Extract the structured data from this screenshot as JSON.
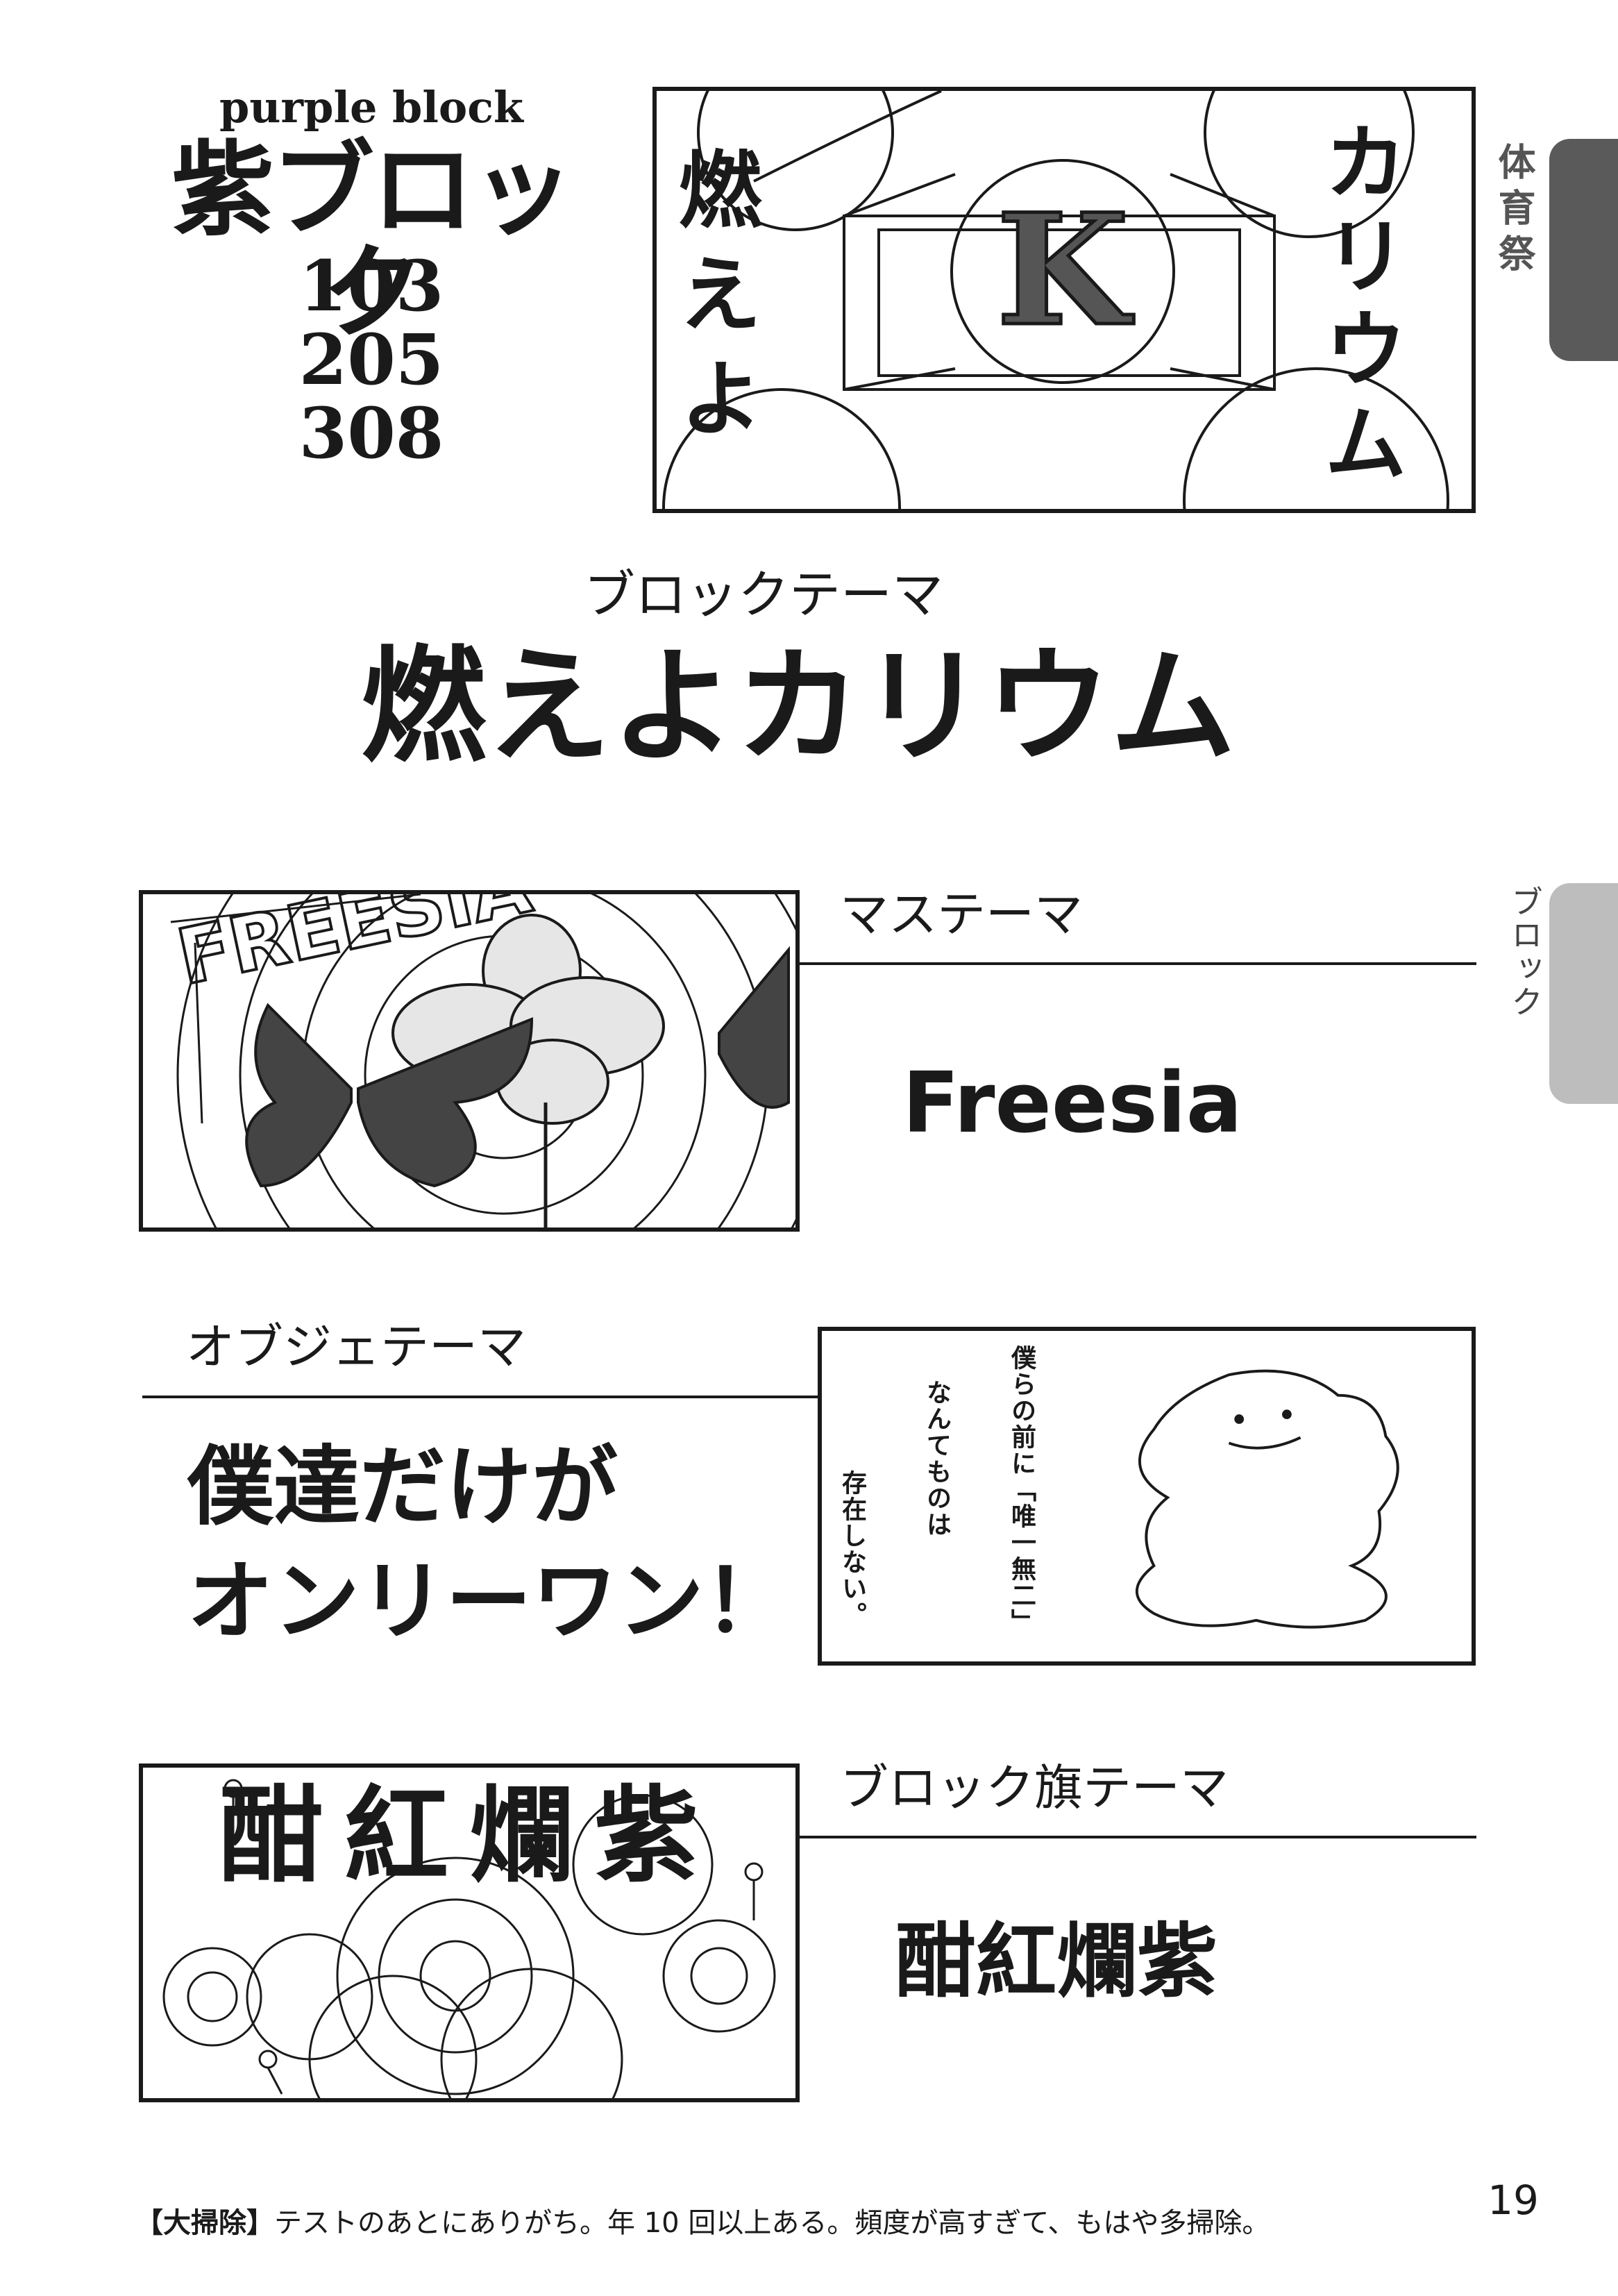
{
  "header": {
    "english_title": "purple block",
    "title": "紫ブロック",
    "classes": [
      "103",
      "205",
      "308"
    ]
  },
  "side_tabs": {
    "section": "体育祭",
    "subsection": "ブロック"
  },
  "block_theme": {
    "label": "ブロックテーマ",
    "value": "燃えよカリウム",
    "illustration": {
      "left_text": "燃えよ",
      "center_letter": "K",
      "right_text": "カリウム"
    }
  },
  "mass_theme": {
    "label": "マステーマ",
    "value": "Freesia",
    "illustration": {
      "text": "FREESIA"
    }
  },
  "object_theme": {
    "label": "オブジェテーマ",
    "value_line1": "僕達だけが",
    "value_line2": "オンリーワン！",
    "illustration": {
      "col1": "僕らの前に「唯一無二」",
      "col2": "なんてものは",
      "col3": "存在しない。"
    }
  },
  "flag_theme": {
    "label": "ブロック旗テーマ",
    "value": "酣紅爛紫",
    "illustration": {
      "text": "酣紅爛紫"
    }
  },
  "footer": {
    "term": "【大掃除】",
    "note": "テストのあとにありがち。年 10 回以上ある。頻度が高すぎて、もはや多掃除。",
    "page_number": "19"
  },
  "colors": {
    "tab_dark": "#5a5a5a",
    "tab_light": "#bdbdbd",
    "ink": "#1a1a1a"
  }
}
